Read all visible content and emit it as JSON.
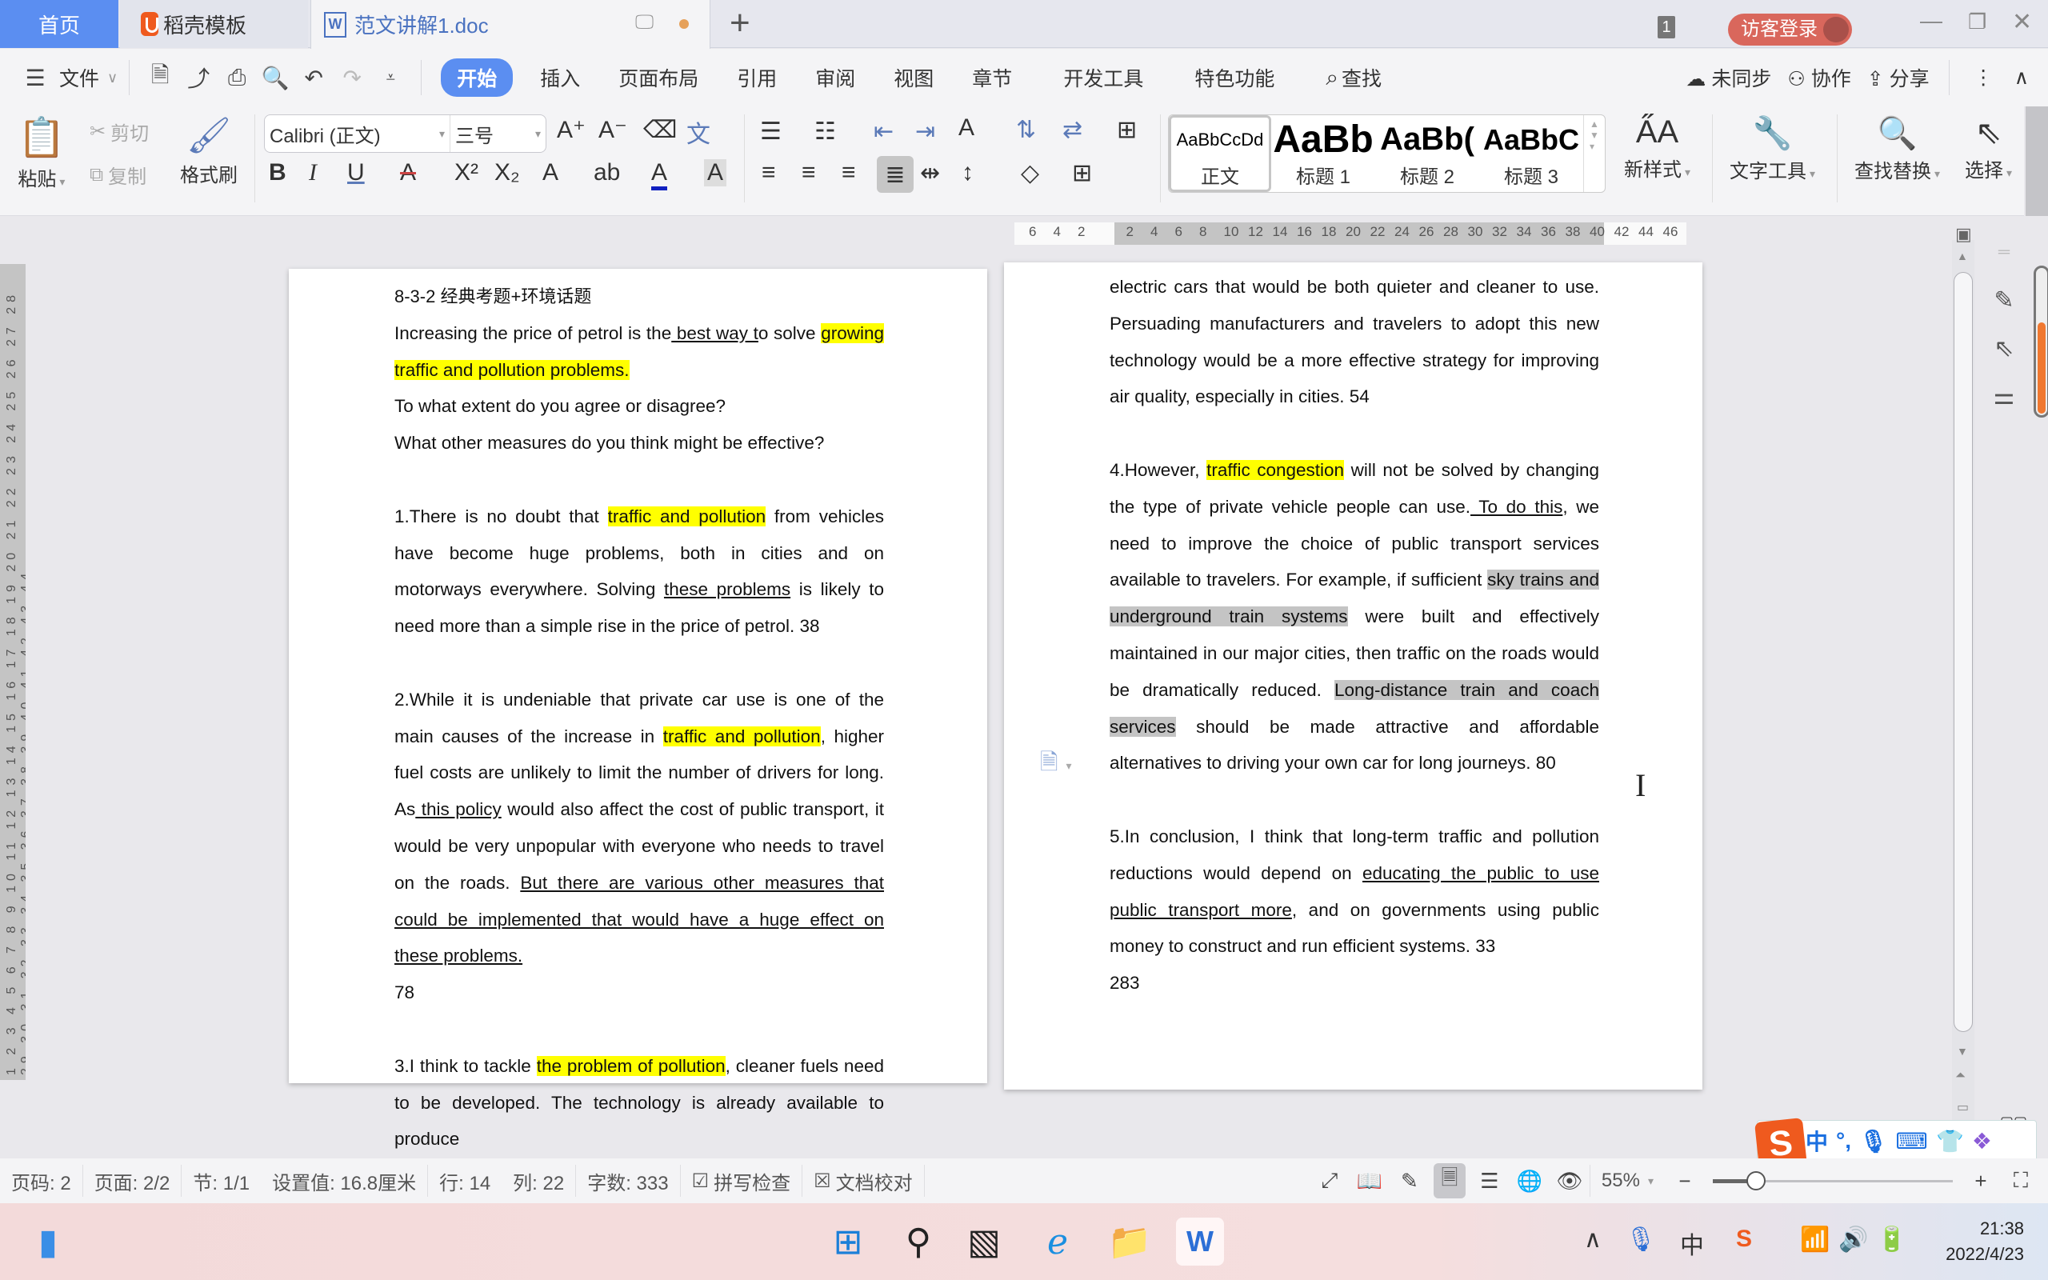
{
  "titlebar": {
    "tabs": [
      {
        "label": "首页"
      },
      {
        "label": "稻壳模板"
      },
      {
        "label": "范文讲解1.doc"
      }
    ],
    "new_tab_label": "+",
    "window_count": "1",
    "login_label": "访客登录"
  },
  "menu": {
    "file_label": "文件",
    "items": [
      "开始",
      "插入",
      "页面布局",
      "引用",
      "审阅",
      "视图",
      "章节",
      "开发工具",
      "特色功能"
    ],
    "search_label": "查找",
    "sync_label": "未同步",
    "collab_label": "协作",
    "share_label": "分享"
  },
  "ribbon": {
    "paste_label": "粘贴",
    "cut_label": "剪切",
    "copy_label": "复制",
    "format_painter_label": "格式刷",
    "font_name": "Calibri (正文)",
    "font_size": "三号",
    "styles": [
      {
        "preview": "AaBbCcDd",
        "label": "正文"
      },
      {
        "preview": "AaBb",
        "label": "标题 1"
      },
      {
        "preview": "AaBb(",
        "label": "标题 2"
      },
      {
        "preview": "AaBbC",
        "label": "标题 3"
      }
    ],
    "new_style_label": "新样式",
    "text_tools_label": "文字工具",
    "find_replace_label": "查找替换",
    "select_label": "选择"
  },
  "ruler": {
    "h_ticks": [
      "6",
      "4",
      "2",
      "2",
      "4",
      "6",
      "8",
      "10",
      "12",
      "14",
      "16",
      "18",
      "20",
      "22",
      "24",
      "26",
      "28",
      "30",
      "32",
      "34",
      "36",
      "38",
      "40",
      "42",
      "44",
      "46"
    ],
    "v_ticks": "1 2 3 4 5 6 7 8 9 10 11 12 13 14 15 16 17 18 19 20 21 22 23 24 25 26 27 28 29 30 31 32 33 34 35 36 37 38 39 40 41 42 43 44"
  },
  "document": {
    "page1": {
      "heading": "8-3-2  经典考题+环境话题",
      "prompt": {
        "a": "Increasing the price of petrol is the",
        "ul": " best way t",
        "b": "o solve ",
        "hl": "growing traffic and pollution problems. "
      },
      "q1": "To what extent do you agree or disagree?",
      "q2": "What other measures do you think might be effective?",
      "p1": {
        "a": "1.There is no doubt that ",
        "hl": "traffic and pollution",
        "b": " from vehicles have become huge problems, both in cities and on motorways everywhere. Solving ",
        "ul": "these problems",
        "c": " is likely to need more than a simple rise in the price of petrol. 38"
      },
      "p2": {
        "a": "2.While it is undeniable that private car use is one of the main causes of the increase in ",
        "hl": "traffic and pollution",
        "b": ", higher fuel costs are unlikely to limit the number of drivers for long. As",
        "ul1": " this policy",
        "c": " would also affect the cost of public transport, it would be very unpopular with everyone who needs to travel on the roads. ",
        "ul2": "But there are various other measures that could be implemented that would have a huge effect on these problems.",
        "d": "78"
      },
      "p3": {
        "a": "3.I think to tackle ",
        "hl": "the problem of pollution",
        "b": ", cleaner fuels need to be developed. The technology is already available to produce"
      }
    },
    "page2": {
      "p3_cont": "electric cars that would be both quieter and cleaner to use. Persuading manufacturers and travelers to adopt this new technology would be a more effective strategy for improving air quality, especially in cities. 54",
      "p4": {
        "a": "4.However, ",
        "hl": "traffic congestion",
        "b": " will not be solved by changing the type of private vehicle people can use.",
        "ul": " To do this",
        "c": ", we need to improve the choice of public transport services available to travelers. For example, if sufficient ",
        "hg1": "sky trains and underground train systems",
        "d": " were built and effectively maintained in our major cities, then traffic on the roads would be dramatically reduced. ",
        "hg2": "Long-distance train and coach services",
        "e": " should be made attractive and affordable alternatives to driving your own car for long journeys. 80"
      },
      "p5": {
        "a": "5.In conclusion, I think that long-term traffic and pollution reductions would depend on ",
        "ul": "educating the public to use public transport more",
        "b": ", and on governments using public money to construct and run efficient systems. 33"
      },
      "total": "283"
    }
  },
  "scroll": {
    "gauge_fraction": 0.62
  },
  "statusbar": {
    "page_num": "页码: 2",
    "pages": "页面: 2/2",
    "section": "节: 1/1",
    "setting": "设置值: 16.8厘米",
    "line": "行: 14",
    "column": "列: 22",
    "word_count": "字数: 333",
    "spell_check": "拼写检查",
    "doc_proof": "文档校对",
    "zoom": "55%",
    "zoom_fraction": 0.18
  },
  "ime": {
    "mode": "中",
    "punct": "°,"
  },
  "taskbar": {
    "time": "21:38",
    "date": "2022/4/23"
  }
}
